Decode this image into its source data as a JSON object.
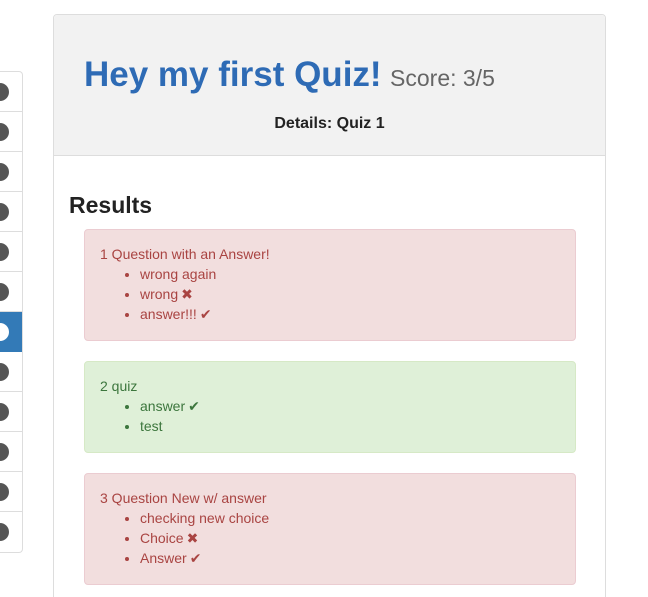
{
  "header": {
    "title": "Hey my first Quiz!",
    "score": "Score: 3/5",
    "details": "Details: Quiz 1"
  },
  "results": {
    "heading": "Results",
    "questions": [
      {
        "label": "1 Question with an Answer!",
        "status": "wrong",
        "choices": [
          {
            "text": "wrong again",
            "mark": ""
          },
          {
            "text": "wrong",
            "mark": "✖"
          },
          {
            "text": "answer!!!",
            "mark": "✔"
          }
        ]
      },
      {
        "label": "2 quiz",
        "status": "right",
        "choices": [
          {
            "text": "answer",
            "mark": "✔"
          },
          {
            "text": "test",
            "mark": ""
          }
        ]
      },
      {
        "label": "3 Question New w/ answer",
        "status": "wrong",
        "choices": [
          {
            "text": "checking new choice",
            "mark": ""
          },
          {
            "text": "Choice",
            "mark": "✖"
          },
          {
            "text": "Answer",
            "mark": "✔"
          }
        ]
      }
    ]
  },
  "sidebar": {
    "active_index": 6,
    "item_count": 12
  },
  "colors": {
    "title": "#2e6bb5",
    "wrong_bg": "#f2dede",
    "wrong_text": "#a94442",
    "right_bg": "#dff0d8",
    "right_text": "#3c763d",
    "active": "#337ab7"
  }
}
